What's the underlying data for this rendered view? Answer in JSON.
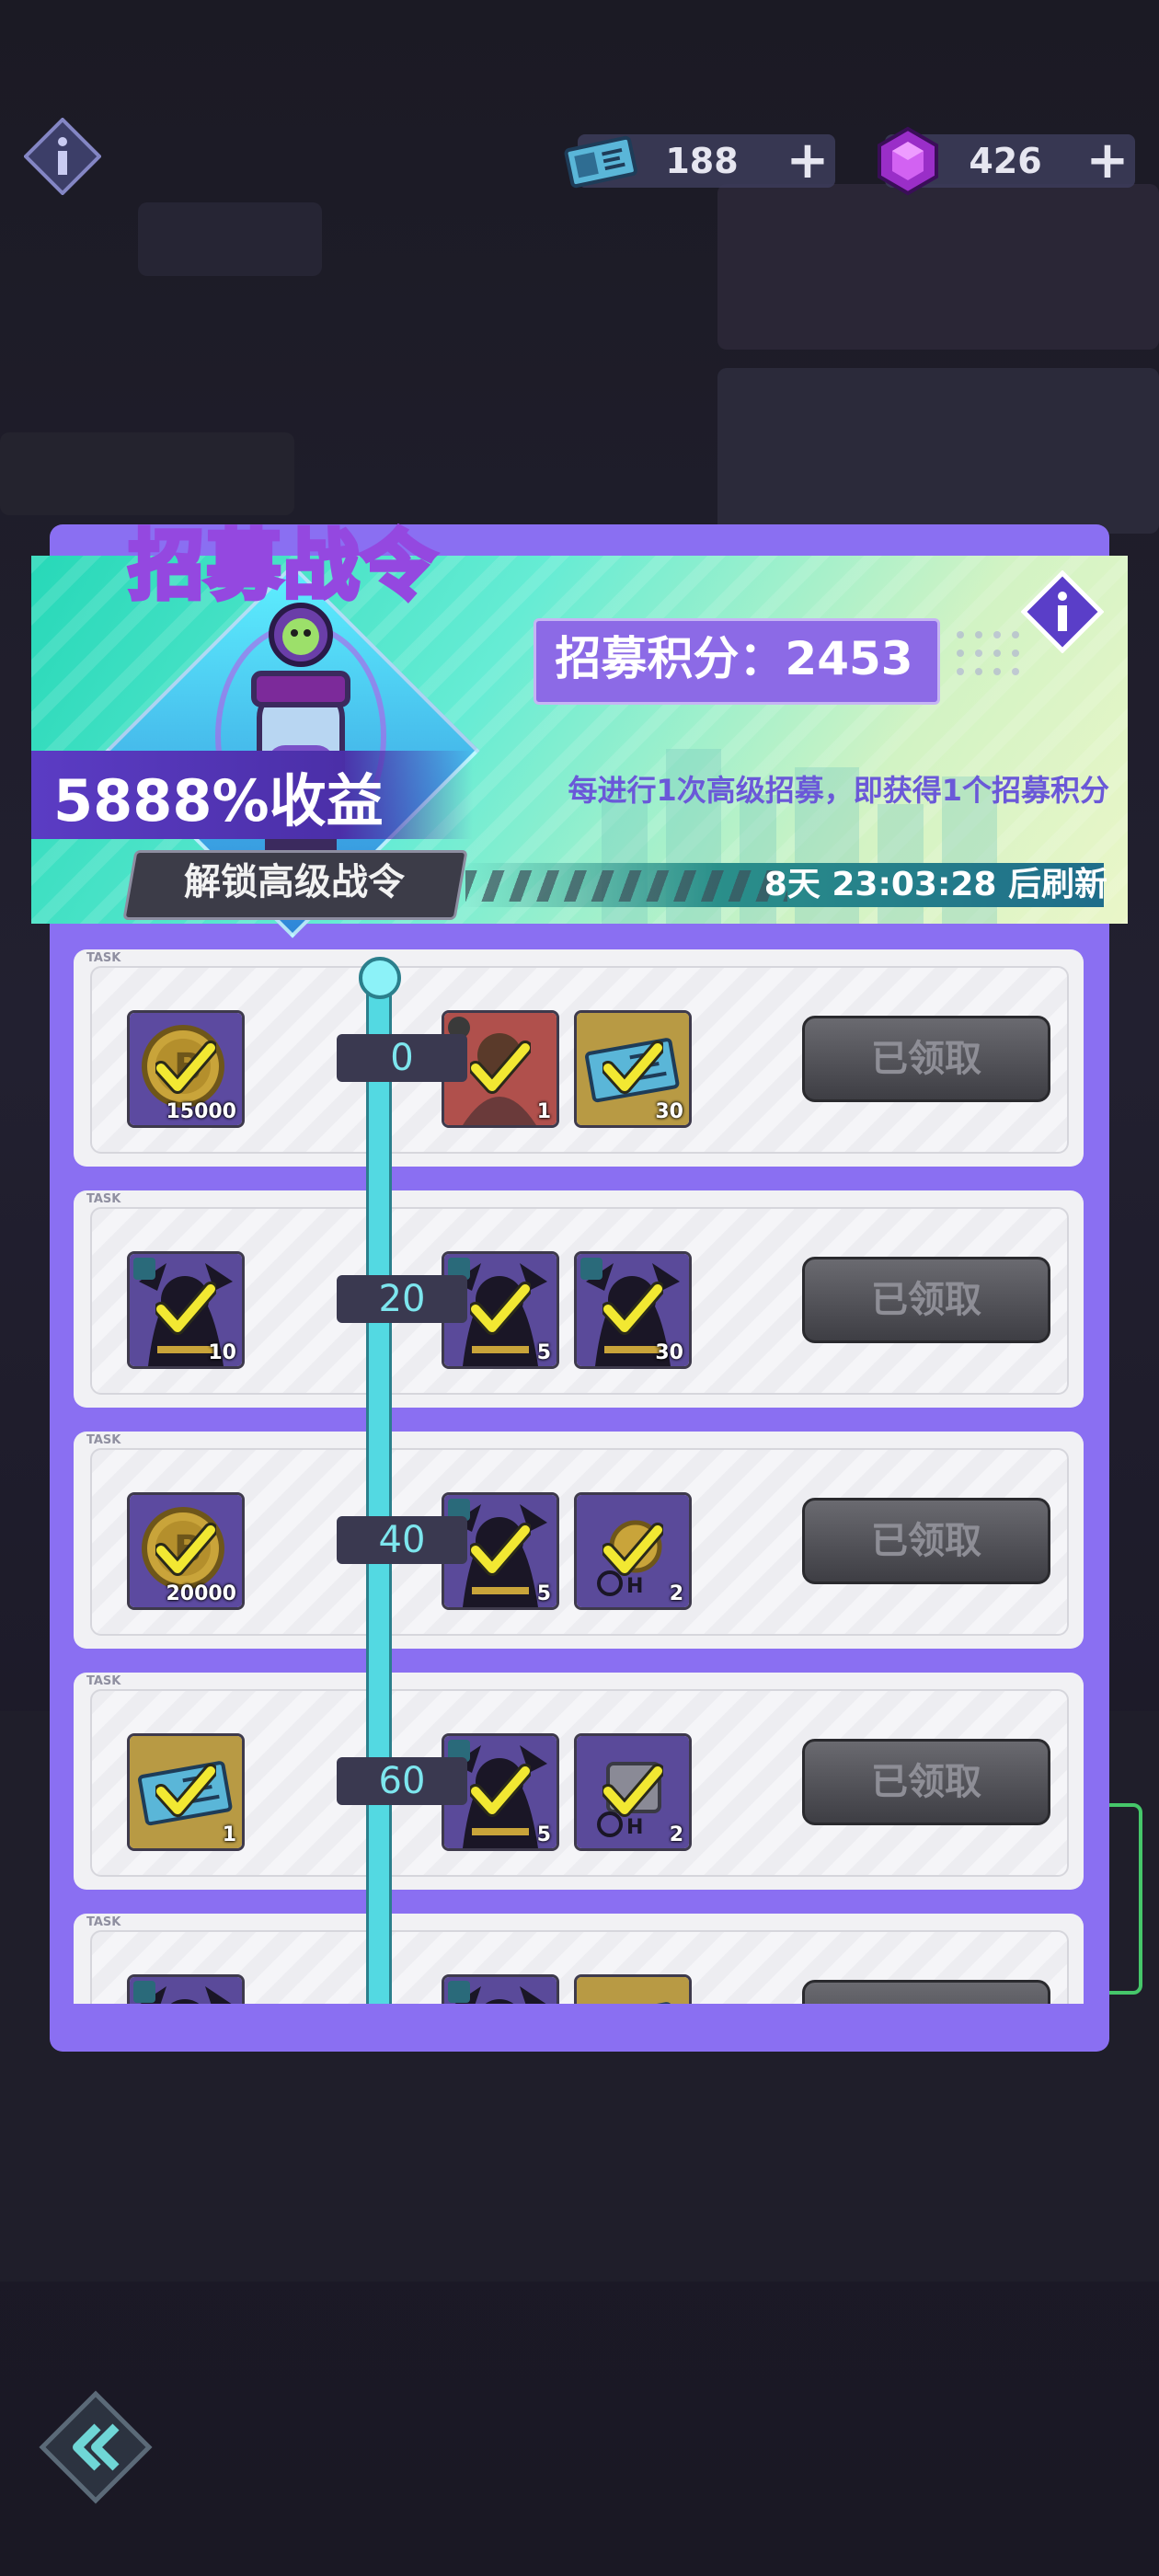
{
  "currency": {
    "tickets": "188",
    "gems": "426",
    "plus": "+"
  },
  "banner": {
    "title": "招募战令",
    "score_label": "招募积分：2453",
    "yield": "5888%收益",
    "unlock_button": "解锁高级战令",
    "description": "每进行1次高级招募，即获得1个招募积分",
    "refresh": "8天 23:03:28 后刷新"
  },
  "task_tag": "TASK",
  "rows": [
    {
      "level": "0",
      "free_item": {
        "icon": "coin-icon",
        "qty": "15000"
      },
      "premium_items": [
        {
          "icon": "hero-card-icon",
          "qty": "1"
        },
        {
          "icon": "ticket-icon",
          "qty": "30"
        }
      ],
      "claim": "已领取"
    },
    {
      "level": "20",
      "free_item": {
        "icon": "shadow-hero-icon",
        "qty": "10"
      },
      "premium_items": [
        {
          "icon": "shadow-hero-icon",
          "qty": "5"
        },
        {
          "icon": "shadow-hero-icon",
          "qty": "30"
        }
      ],
      "claim": "已领取"
    },
    {
      "level": "40",
      "free_item": {
        "icon": "coin-icon",
        "qty": "20000"
      },
      "premium_items": [
        {
          "icon": "shadow-hero-icon",
          "qty": "5"
        },
        {
          "icon": "time-coin-icon",
          "qty": "2"
        }
      ],
      "claim": "已领取"
    },
    {
      "level": "60",
      "free_item": {
        "icon": "ticket-icon",
        "qty": "1"
      },
      "premium_items": [
        {
          "icon": "shadow-hero-icon",
          "qty": "5"
        },
        {
          "icon": "time-chest-icon",
          "qty": "2"
        }
      ],
      "claim": "已领取"
    },
    {
      "level": "",
      "free_item": {
        "icon": "shadow-hero-icon",
        "qty": ""
      },
      "premium_items": [
        {
          "icon": "shadow-hero-icon",
          "qty": ""
        },
        {
          "icon": "ticket-icon",
          "qty": ""
        }
      ],
      "claim": ""
    }
  ]
}
